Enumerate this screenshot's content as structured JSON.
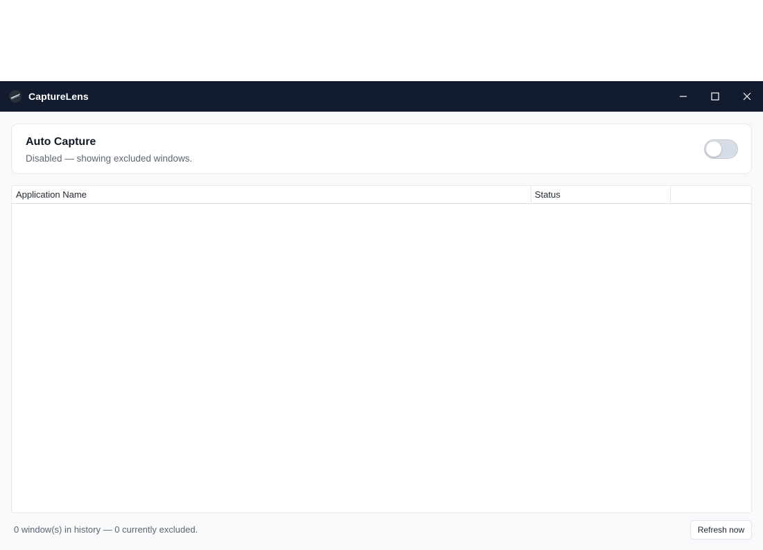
{
  "window": {
    "title": "CaptureLens",
    "icon": "capturelens-logo-icon",
    "controls": [
      "minimize-icon",
      "maximize-icon",
      "close-icon"
    ]
  },
  "auto_capture": {
    "title": "Auto Capture",
    "subtitle": "Disabled — showing excluded windows.",
    "toggle_on": false
  },
  "table": {
    "columns": [
      "Application Name",
      "Status",
      ""
    ],
    "rows": []
  },
  "footer": {
    "summary": "0 window(s) in history — 0 currently excluded.",
    "refresh_label": "Refresh now"
  },
  "colors": {
    "titlebar": "#121c2e",
    "background": "#f7f9fb",
    "toggle_off": "#d6dde6"
  }
}
